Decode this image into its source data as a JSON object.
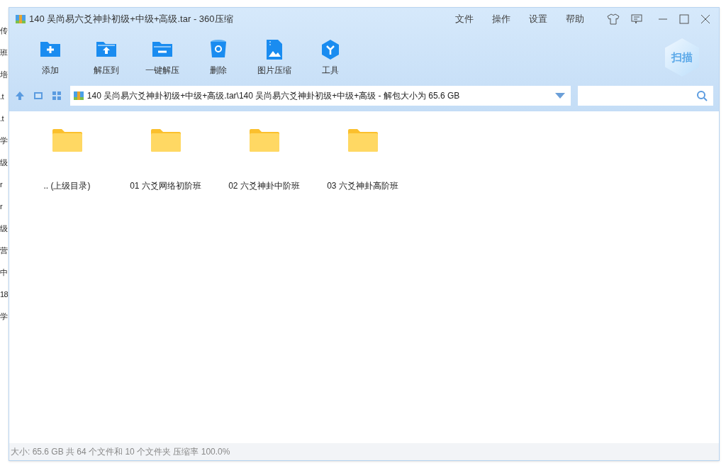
{
  "background_window": {
    "fragments": [
      "传",
      "班",
      "培",
      ".t",
      ".t",
      "学",
      "级",
      "r",
      "r",
      "级",
      "营",
      "中",
      "18",
      "学"
    ]
  },
  "window": {
    "title": "140 吴尚易六爻神卦初级+中级+高级.tar - 360压缩"
  },
  "menu": [
    "文件",
    "操作",
    "设置",
    "帮助"
  ],
  "toolbar": [
    {
      "kind": "add",
      "label": "添加"
    },
    {
      "kind": "extract",
      "label": "解压到"
    },
    {
      "kind": "oneclick",
      "label": "一键解压"
    },
    {
      "kind": "delete",
      "label": "删除"
    },
    {
      "kind": "image",
      "label": "图片压缩"
    },
    {
      "kind": "tools",
      "label": "工具"
    }
  ],
  "scan_button": {
    "label": "扫描"
  },
  "address_bar": {
    "value": "140 吴尚易六爻神卦初级+中级+高级.tar\\140 吴尚易六爻神卦初级+中级+高级 - 解包大小为 65.6 GB"
  },
  "items": [
    {
      "label": ".. (上级目录)"
    },
    {
      "label": "01 六爻网络初阶班"
    },
    {
      "label": "02 六爻神卦中阶班"
    },
    {
      "label": "03 六爻神卦高阶班"
    }
  ],
  "status_bar": "大小: 65.6 GB 共 64 个文件和 10 个文件夹 压缩率 100.0%"
}
